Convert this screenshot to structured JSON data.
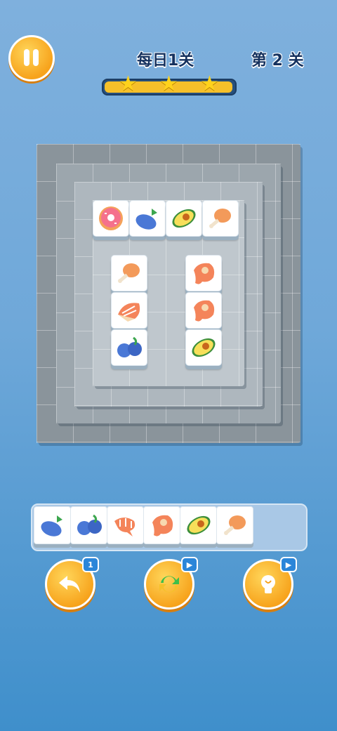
{
  "header": {
    "daily_label": "每日1关",
    "level_label": "第 2 关",
    "progress_fraction": 0.97,
    "stars_filled": 3
  },
  "board": {
    "top_tiles": [
      {
        "row": 0,
        "col": 0,
        "icon": "donut-icon"
      },
      {
        "row": 0,
        "col": 1,
        "icon": "eggplant-icon"
      },
      {
        "row": 0,
        "col": 2,
        "icon": "avocado-icon"
      },
      {
        "row": 0,
        "col": 3,
        "icon": "drumstick-icon"
      },
      {
        "row": 1,
        "col": 0,
        "icon": "drumstick-icon"
      },
      {
        "row": 1,
        "col": 2,
        "icon": "steak-icon"
      },
      {
        "row": 2,
        "col": 0,
        "icon": "salmon-icon"
      },
      {
        "row": 2,
        "col": 2,
        "icon": "steak-icon"
      },
      {
        "row": 3,
        "col": 0,
        "icon": "blueberry-icon"
      },
      {
        "row": 3,
        "col": 2,
        "icon": "avocado-icon"
      }
    ]
  },
  "tray": {
    "slots": 7,
    "items": [
      "eggplant-icon",
      "blueberry-icon",
      "shrimp-icon",
      "steak-icon",
      "avocado-icon",
      "drumstick-icon"
    ]
  },
  "controls": {
    "undo_badge": "1",
    "shuffle_badge": "▶",
    "hint_badge": "▶"
  },
  "colors": {
    "accent": "#f7a31c",
    "title": "#16325f",
    "badge": "#2b86d9"
  }
}
